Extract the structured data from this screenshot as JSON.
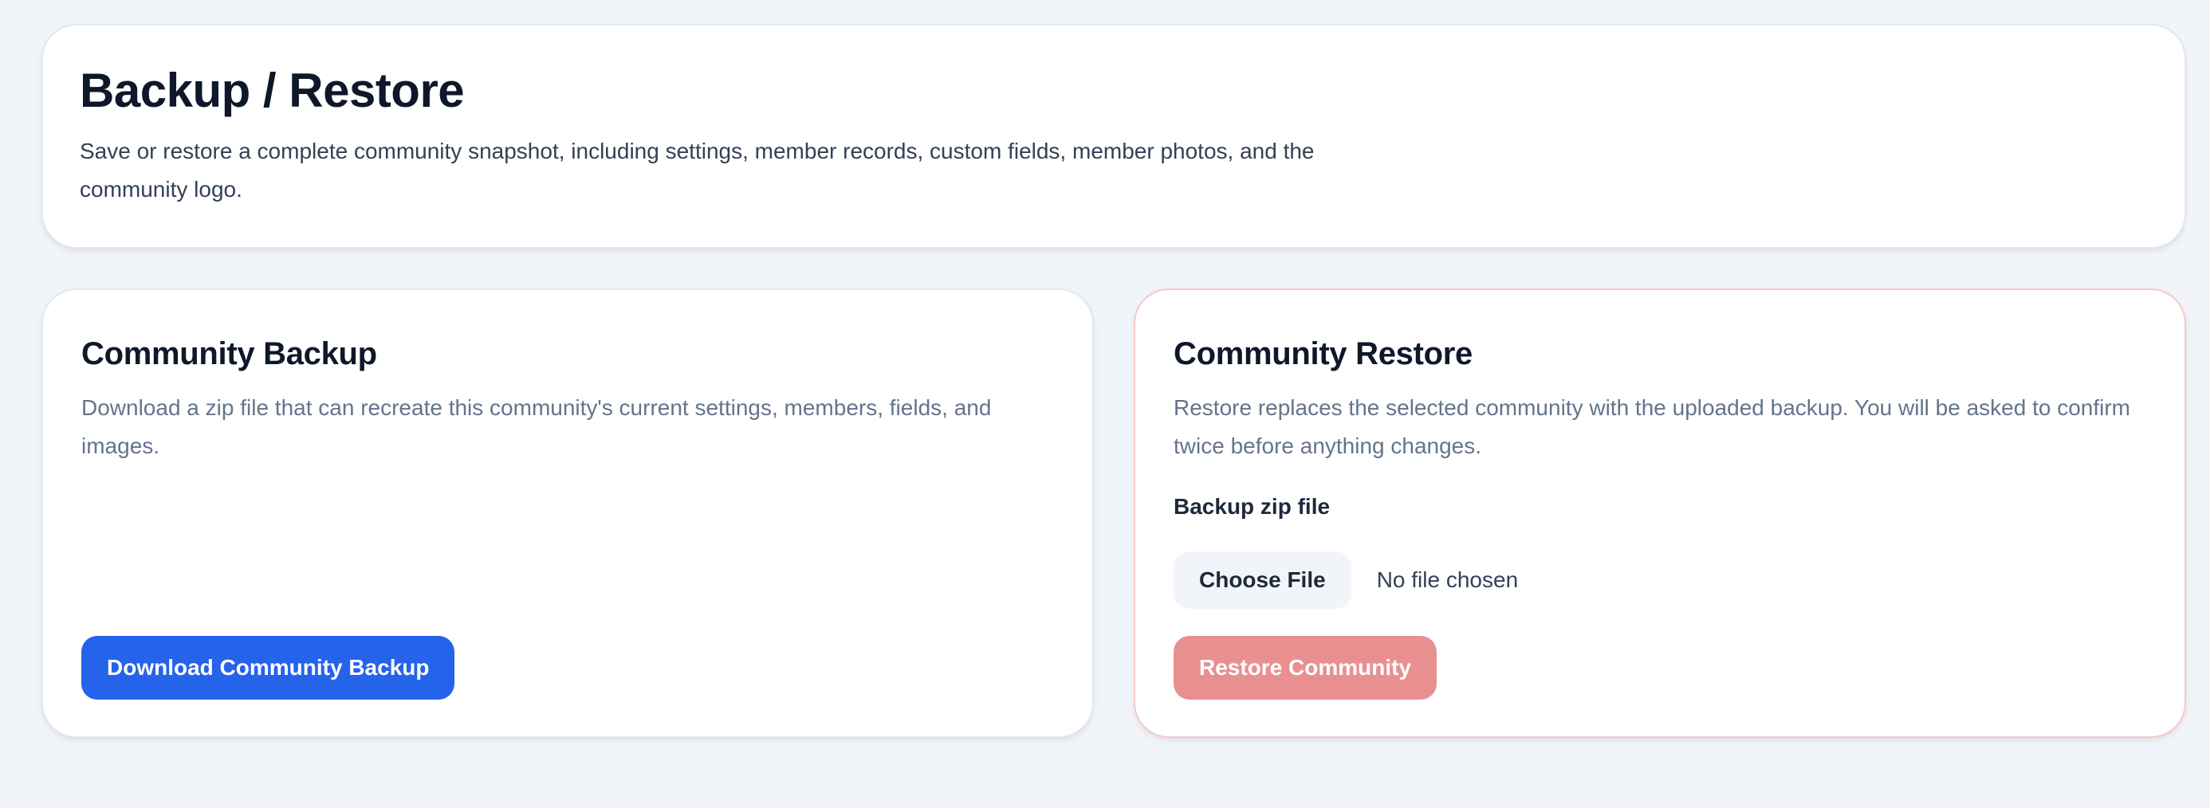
{
  "header": {
    "title": "Backup / Restore",
    "description": "Save or restore a complete community snapshot, including settings, member records, custom fields, member photos, and the community logo."
  },
  "backup": {
    "title": "Community Backup",
    "description": "Download a zip file that can recreate this community's current settings, members, fields, and images.",
    "button_label": "Download Community Backup"
  },
  "restore": {
    "title": "Community Restore",
    "description": "Restore replaces the selected community with the uploaded backup. You will be asked to confirm twice before anything changes.",
    "file_label": "Backup zip file",
    "choose_file_label": "Choose File",
    "file_status": "No file chosen",
    "button_label": "Restore Community",
    "button_disabled": true
  },
  "colors": {
    "background": "#f1f4f9",
    "primary": "#2563eb",
    "danger_disabled": "#e89090",
    "restore_border": "#f6c9c9"
  }
}
